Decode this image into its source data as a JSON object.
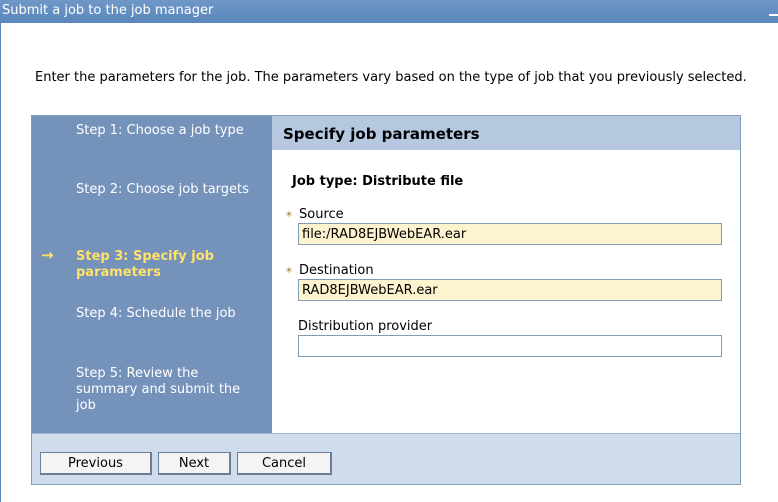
{
  "window": {
    "title": "Submit a job to the job manager"
  },
  "intro": "Enter the parameters for the job. The parameters vary based on the type of job that you previously selected.",
  "steps": [
    {
      "label": "Step 1: Choose a job type",
      "current": false
    },
    {
      "label": "Step 2: Choose job targets",
      "current": false
    },
    {
      "label": "Step 3: Specify job parameters",
      "current": true
    },
    {
      "label": "Step 4: Schedule the job",
      "current": false
    },
    {
      "label": "Step 5: Review the summary and submit the job",
      "current": false
    }
  ],
  "current_step_icon": "right-arrow-icon",
  "content": {
    "heading": "Specify job parameters",
    "job_type": "Job type: Distribute file",
    "required_marker": "*",
    "fields": {
      "source": {
        "label": "Source",
        "value": "file:/RAD8EJBWebEAR.ear",
        "required": true
      },
      "destination": {
        "label": "Destination",
        "value": "RAD8EJBWebEAR.ear",
        "required": true
      },
      "provider": {
        "label": "Distribution provider",
        "value": "",
        "required": false
      }
    }
  },
  "buttons": {
    "previous": "Previous",
    "next": "Next",
    "cancel": "Cancel"
  },
  "colors": {
    "titlebar": "#5a86bb",
    "steps_panel": "#7592bb",
    "current_step": "#ffe16b",
    "header_band": "#b5c8e0",
    "filled_field": "#fdf3cf",
    "footer": "#cfdcec"
  }
}
